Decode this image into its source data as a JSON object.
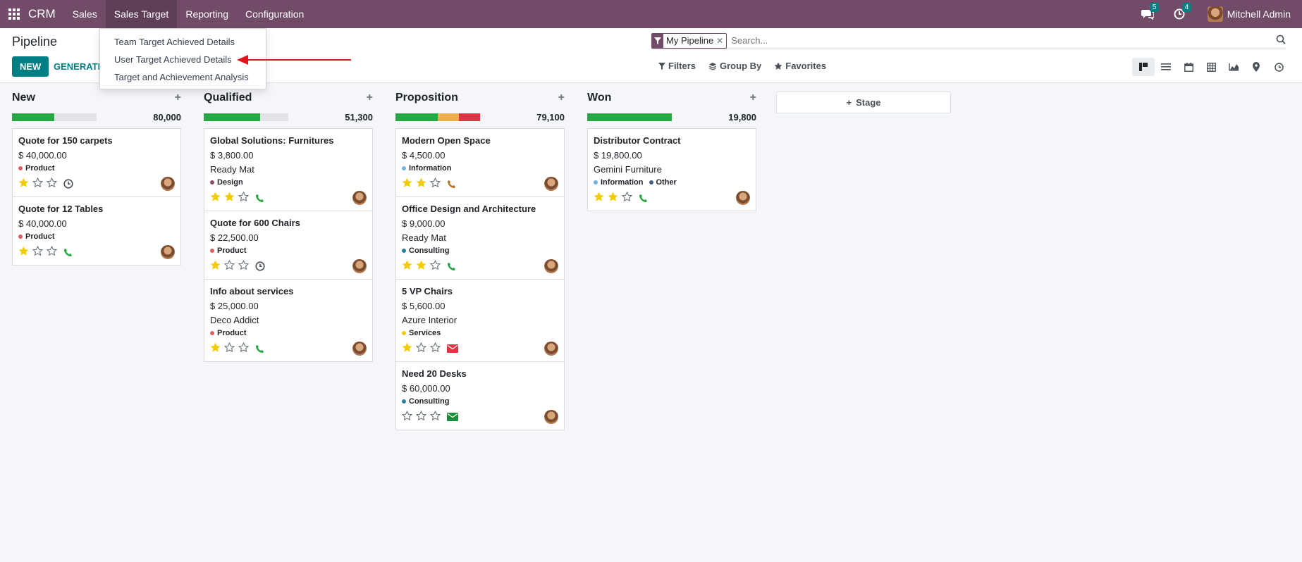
{
  "navbar": {
    "brand": "CRM",
    "menu": [
      "Sales",
      "Sales Target",
      "Reporting",
      "Configuration"
    ],
    "messages_count": "5",
    "activities_count": "4",
    "user_name": "Mitchell Admin"
  },
  "control_panel": {
    "title": "Pipeline",
    "new_label": "NEW",
    "generate_label": "GENERATE",
    "facet_label": "My Pipeline",
    "search_placeholder": "Search...",
    "filters_label": "Filters",
    "groupby_label": "Group By",
    "favorites_label": "Favorites"
  },
  "dropdown": {
    "items": [
      "Team Target Achieved Details",
      "User Target Achieved Details",
      "Target and Achievement Analysis"
    ]
  },
  "colors": {
    "brand": "#714b67",
    "accent": "#017e84",
    "progress_green": "#28a745",
    "progress_orange": "#f0ad4e",
    "progress_red": "#dc3545",
    "star": "#f3cc00"
  },
  "stage_add_label": "Stage",
  "columns": [
    {
      "title": "New",
      "total": "80,000",
      "progress": [
        {
          "color": "#28a745",
          "fraction": 0.5
        }
      ],
      "cards": [
        {
          "title": "Quote for 150 carpets",
          "amount": "$ 40,000.00",
          "company": "",
          "tags": [
            {
              "name": "Product",
              "color": "#e05d5d"
            }
          ],
          "stars": 1,
          "activity": "clock-icon"
        },
        {
          "title": "Quote for 12 Tables",
          "amount": "$ 40,000.00",
          "company": "",
          "tags": [
            {
              "name": "Product",
              "color": "#e05d5d"
            }
          ],
          "stars": 1,
          "activity": "phone-icon"
        }
      ]
    },
    {
      "title": "Qualified",
      "total": "51,300",
      "progress": [
        {
          "color": "#28a745",
          "fraction": 0.67
        }
      ],
      "cards": [
        {
          "title": "Global Solutions: Furnitures",
          "amount": "$ 3,800.00",
          "company": "Ready Mat",
          "tags": [
            {
              "name": "Design",
              "color": "#8e4c6a"
            }
          ],
          "stars": 2,
          "activity": "phone-icon"
        },
        {
          "title": "Quote for 600 Chairs",
          "amount": "$ 22,500.00",
          "company": "",
          "tags": [
            {
              "name": "Product",
              "color": "#e05d5d"
            }
          ],
          "stars": 1,
          "activity": "clock-icon"
        },
        {
          "title": "Info about services",
          "amount": "$ 25,000.00",
          "company": "Deco Addict",
          "tags": [
            {
              "name": "Product",
              "color": "#e05d5d"
            }
          ],
          "stars": 1,
          "activity": "phone-icon"
        }
      ]
    },
    {
      "title": "Proposition",
      "total": "79,100",
      "progress": [
        {
          "color": "#28a745",
          "fraction": 0.5
        },
        {
          "color": "#f0ad4e",
          "fraction": 0.25
        },
        {
          "color": "#dc3545",
          "fraction": 0.25
        }
      ],
      "cards": [
        {
          "title": "Modern Open Space",
          "amount": "$ 4,500.00",
          "company": "",
          "tags": [
            {
              "name": "Information",
              "color": "#6cb4e0"
            }
          ],
          "stars": 2,
          "activity": "phone-orange-icon"
        },
        {
          "title": "Office Design and Architecture",
          "amount": "$ 9,000.00",
          "company": "Ready Mat",
          "tags": [
            {
              "name": "Consulting",
              "color": "#2b7fa0"
            }
          ],
          "stars": 2,
          "activity": "phone-icon"
        },
        {
          "title": "5 VP Chairs",
          "amount": "$ 5,600.00",
          "company": "Azure Interior",
          "tags": [
            {
              "name": "Services",
              "color": "#f3cc00"
            }
          ],
          "stars": 1,
          "activity": "envelope-red-icon"
        },
        {
          "title": "Need 20 Desks",
          "amount": "$ 60,000.00",
          "company": "",
          "tags": [
            {
              "name": "Consulting",
              "color": "#2b7fa0"
            }
          ],
          "stars": 0,
          "activity": "envelope-green-icon"
        }
      ]
    },
    {
      "title": "Won",
      "total": "19,800",
      "progress": [
        {
          "color": "#28a745",
          "fraction": 1.0
        }
      ],
      "cards": [
        {
          "title": "Distributor Contract",
          "amount": "$ 19,800.00",
          "company": "Gemini Furniture",
          "tags": [
            {
              "name": "Information",
              "color": "#6cb4e0"
            },
            {
              "name": "Other",
              "color": "#3e5b8a"
            }
          ],
          "stars": 2,
          "activity": "phone-icon"
        }
      ]
    }
  ]
}
